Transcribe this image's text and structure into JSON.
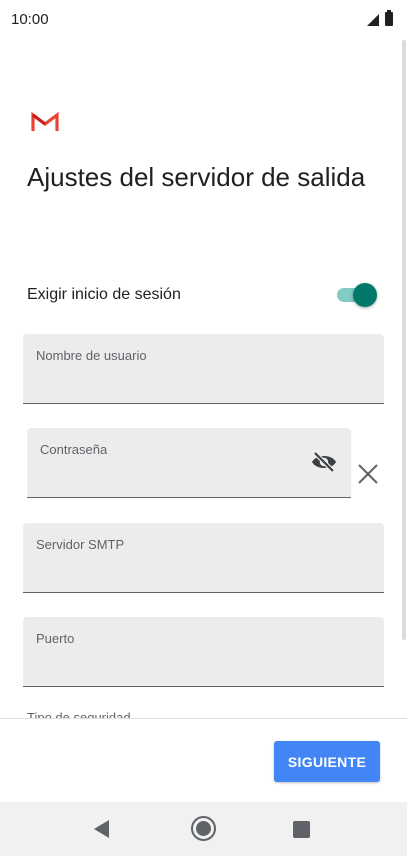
{
  "status_bar": {
    "time": "10:00"
  },
  "page": {
    "title": "Ajustes del servidor de salida"
  },
  "toggle": {
    "label": "Exigir inicio de sesión",
    "checked": true,
    "color_on": "#00796b"
  },
  "fields": {
    "username": {
      "label": "Nombre de usuario",
      "value": ""
    },
    "password": {
      "label": "Contraseña",
      "value": ""
    },
    "smtp_server": {
      "label": "Servidor SMTP",
      "value": ""
    },
    "port": {
      "label": "Puerto",
      "value": ""
    },
    "security_type": {
      "label": "Tipo de seguridad"
    }
  },
  "footer": {
    "next_label": "SIGUIENTE"
  },
  "colors": {
    "primary_button": "#4285f4",
    "field_background": "#ececec",
    "gmail_red": "#ea4335"
  },
  "icons": {
    "logo": "gmail-logo-icon",
    "password_visibility": "eye-off-icon",
    "clear": "close-icon",
    "nav_back": "back-triangle-icon",
    "nav_home": "home-circle-icon",
    "nav_recents": "recents-square-icon"
  }
}
